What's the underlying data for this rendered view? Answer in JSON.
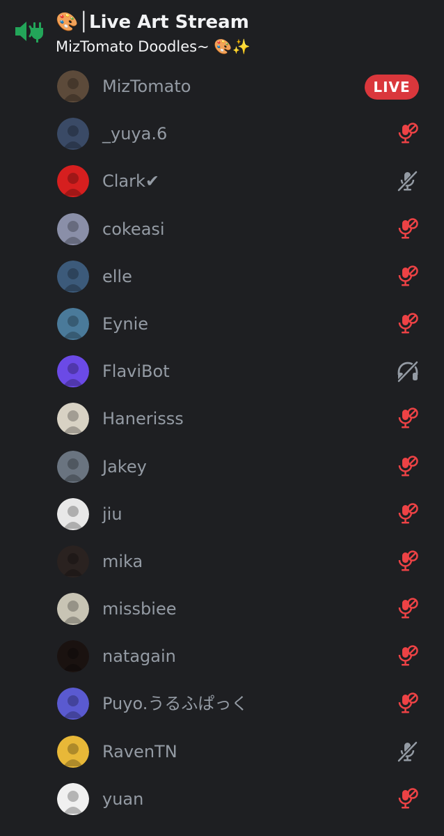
{
  "channel": {
    "title": "🎨│Live Art Stream",
    "subtitle": "MizTomato Doodles~ 🎨✨",
    "icon": "voice-channel-speaker-icon"
  },
  "live_badge": "LIVE",
  "colors": {
    "background": "#1e1f22",
    "muted_red": "#ed4245",
    "icon_grey": "#949ba4",
    "live_red": "#da373c",
    "voice_green": "#23a559"
  },
  "members": [
    {
      "name": "MizTomato",
      "status": "live",
      "avatar_bg": "#5c4a3a"
    },
    {
      "name": "_yuya.6",
      "status": "server-muted",
      "avatar_bg": "#3a4a66"
    },
    {
      "name": "Clark✔",
      "status": "muted",
      "avatar_bg": "#d61f1f"
    },
    {
      "name": "cokeasi",
      "status": "server-muted",
      "avatar_bg": "#8a8fa8"
    },
    {
      "name": "elle",
      "status": "server-muted",
      "avatar_bg": "#3c5a7a"
    },
    {
      "name": "Eynie",
      "status": "server-muted",
      "avatar_bg": "#4a7a9a"
    },
    {
      "name": "FlaviBot",
      "status": "deafened",
      "avatar_bg": "#6b4ae6"
    },
    {
      "name": "Hanerisss",
      "status": "server-muted",
      "avatar_bg": "#d8d2c4"
    },
    {
      "name": "Jakey",
      "status": "server-muted",
      "avatar_bg": "#6a7480"
    },
    {
      "name": "jiu",
      "status": "server-muted",
      "avatar_bg": "#e8e8e8"
    },
    {
      "name": "mika",
      "status": "server-muted",
      "avatar_bg": "#2a2220"
    },
    {
      "name": "missbiee",
      "status": "server-muted",
      "avatar_bg": "#c8c4b4"
    },
    {
      "name": "natagain",
      "status": "server-muted",
      "avatar_bg": "#1a1210"
    },
    {
      "name": "Puyo.うるふぱっく",
      "status": "server-muted",
      "avatar_bg": "#5a5ad0"
    },
    {
      "name": "RavenTN",
      "status": "muted",
      "avatar_bg": "#e8b838"
    },
    {
      "name": "yuan",
      "status": "server-muted",
      "avatar_bg": "#f0f0f0"
    }
  ]
}
